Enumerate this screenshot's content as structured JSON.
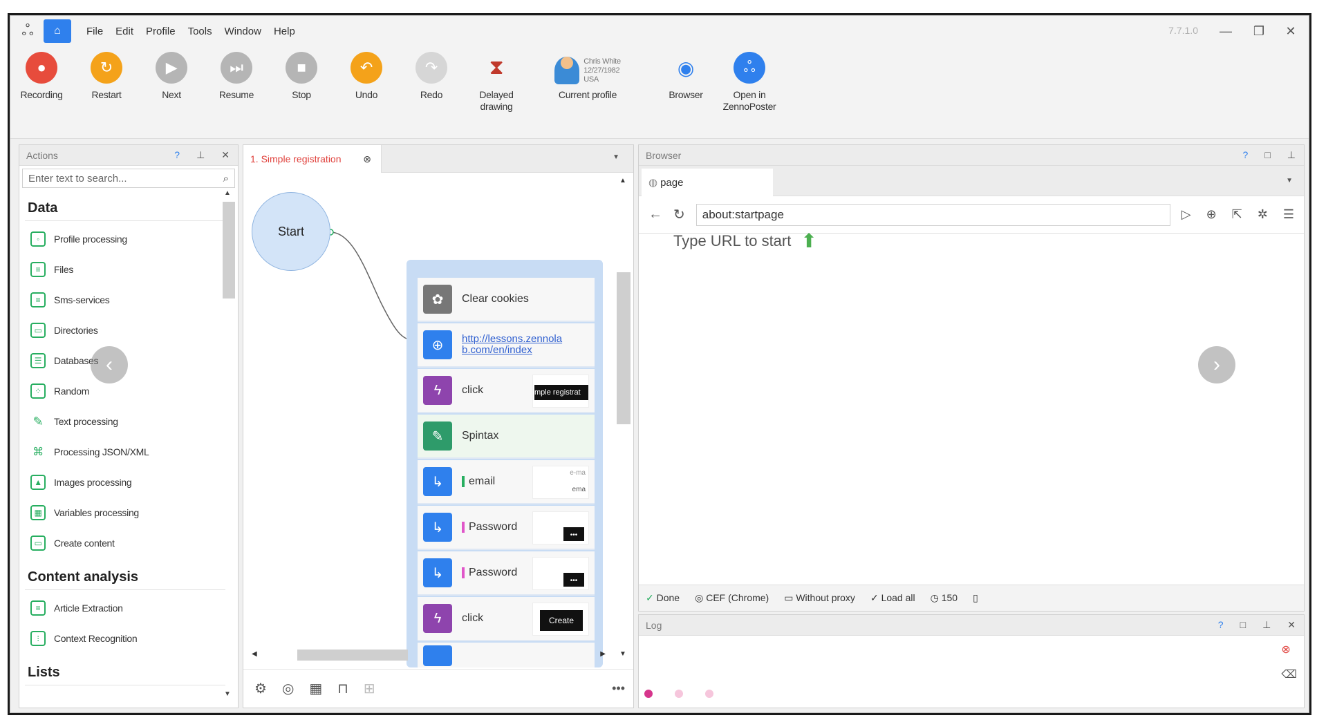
{
  "menubar": {
    "items": [
      "File",
      "Edit",
      "Profile",
      "Tools",
      "Window",
      "Help"
    ],
    "version": "7.7.1.0"
  },
  "toolbar": {
    "recording": "Recording",
    "restart": "Restart",
    "next": "Next",
    "resume": "Resume",
    "stop": "Stop",
    "undo": "Undo",
    "redo": "Redo",
    "delayed_1": "Delayed",
    "delayed_2": "drawing",
    "current_profile": "Current profile",
    "profile_name": "Chris White",
    "profile_date": "12/27/1982",
    "profile_country": "USA",
    "browser": "Browser",
    "open_1": "Open in",
    "open_2": "ZennoPoster"
  },
  "actions": {
    "title": "Actions",
    "search_placeholder": "Enter text to search...",
    "sections": [
      {
        "title": "Data",
        "items": [
          "Profile processing",
          "Files",
          "Sms-services",
          "Directories",
          "Databases",
          "Random",
          "Text processing",
          "Processing JSON/XML",
          "Images processing",
          "Variables processing",
          "Create content"
        ]
      },
      {
        "title": "Content analysis",
        "items": [
          "Article Extraction",
          "Context Recognition"
        ]
      },
      {
        "title": "Lists",
        "items": []
      }
    ]
  },
  "canvas": {
    "tab_label": "1. Simple registration",
    "start": "Start",
    "nodes": [
      {
        "label": "Clear cookies"
      },
      {
        "label": "http://lessons.zennolab.com/en/index"
      },
      {
        "label": "click",
        "thumb": "mple registrat"
      },
      {
        "label": "Spintax"
      },
      {
        "label": "email",
        "thumb_top": "e-ma",
        "thumb_bottom": "ema"
      },
      {
        "label": "Password"
      },
      {
        "label": "Password"
      },
      {
        "label": "click",
        "thumb": "Create"
      }
    ],
    "link_line1": "http://lessons.zennola",
    "link_line2": "b.com/en/index"
  },
  "browser": {
    "title": "Browser",
    "tab": "page",
    "url": "about:startpage",
    "hint": "Type URL to start",
    "status": {
      "done": "Done",
      "engine": "CEF (Chrome)",
      "proxy": "Without proxy",
      "load": "Load all",
      "count": "150"
    }
  },
  "log": {
    "title": "Log"
  },
  "colors": {
    "accent": "#2f80ed",
    "record": "#e74c3c",
    "orange": "#f4a21a",
    "green": "#27ae60",
    "purple": "#8e44ad"
  }
}
